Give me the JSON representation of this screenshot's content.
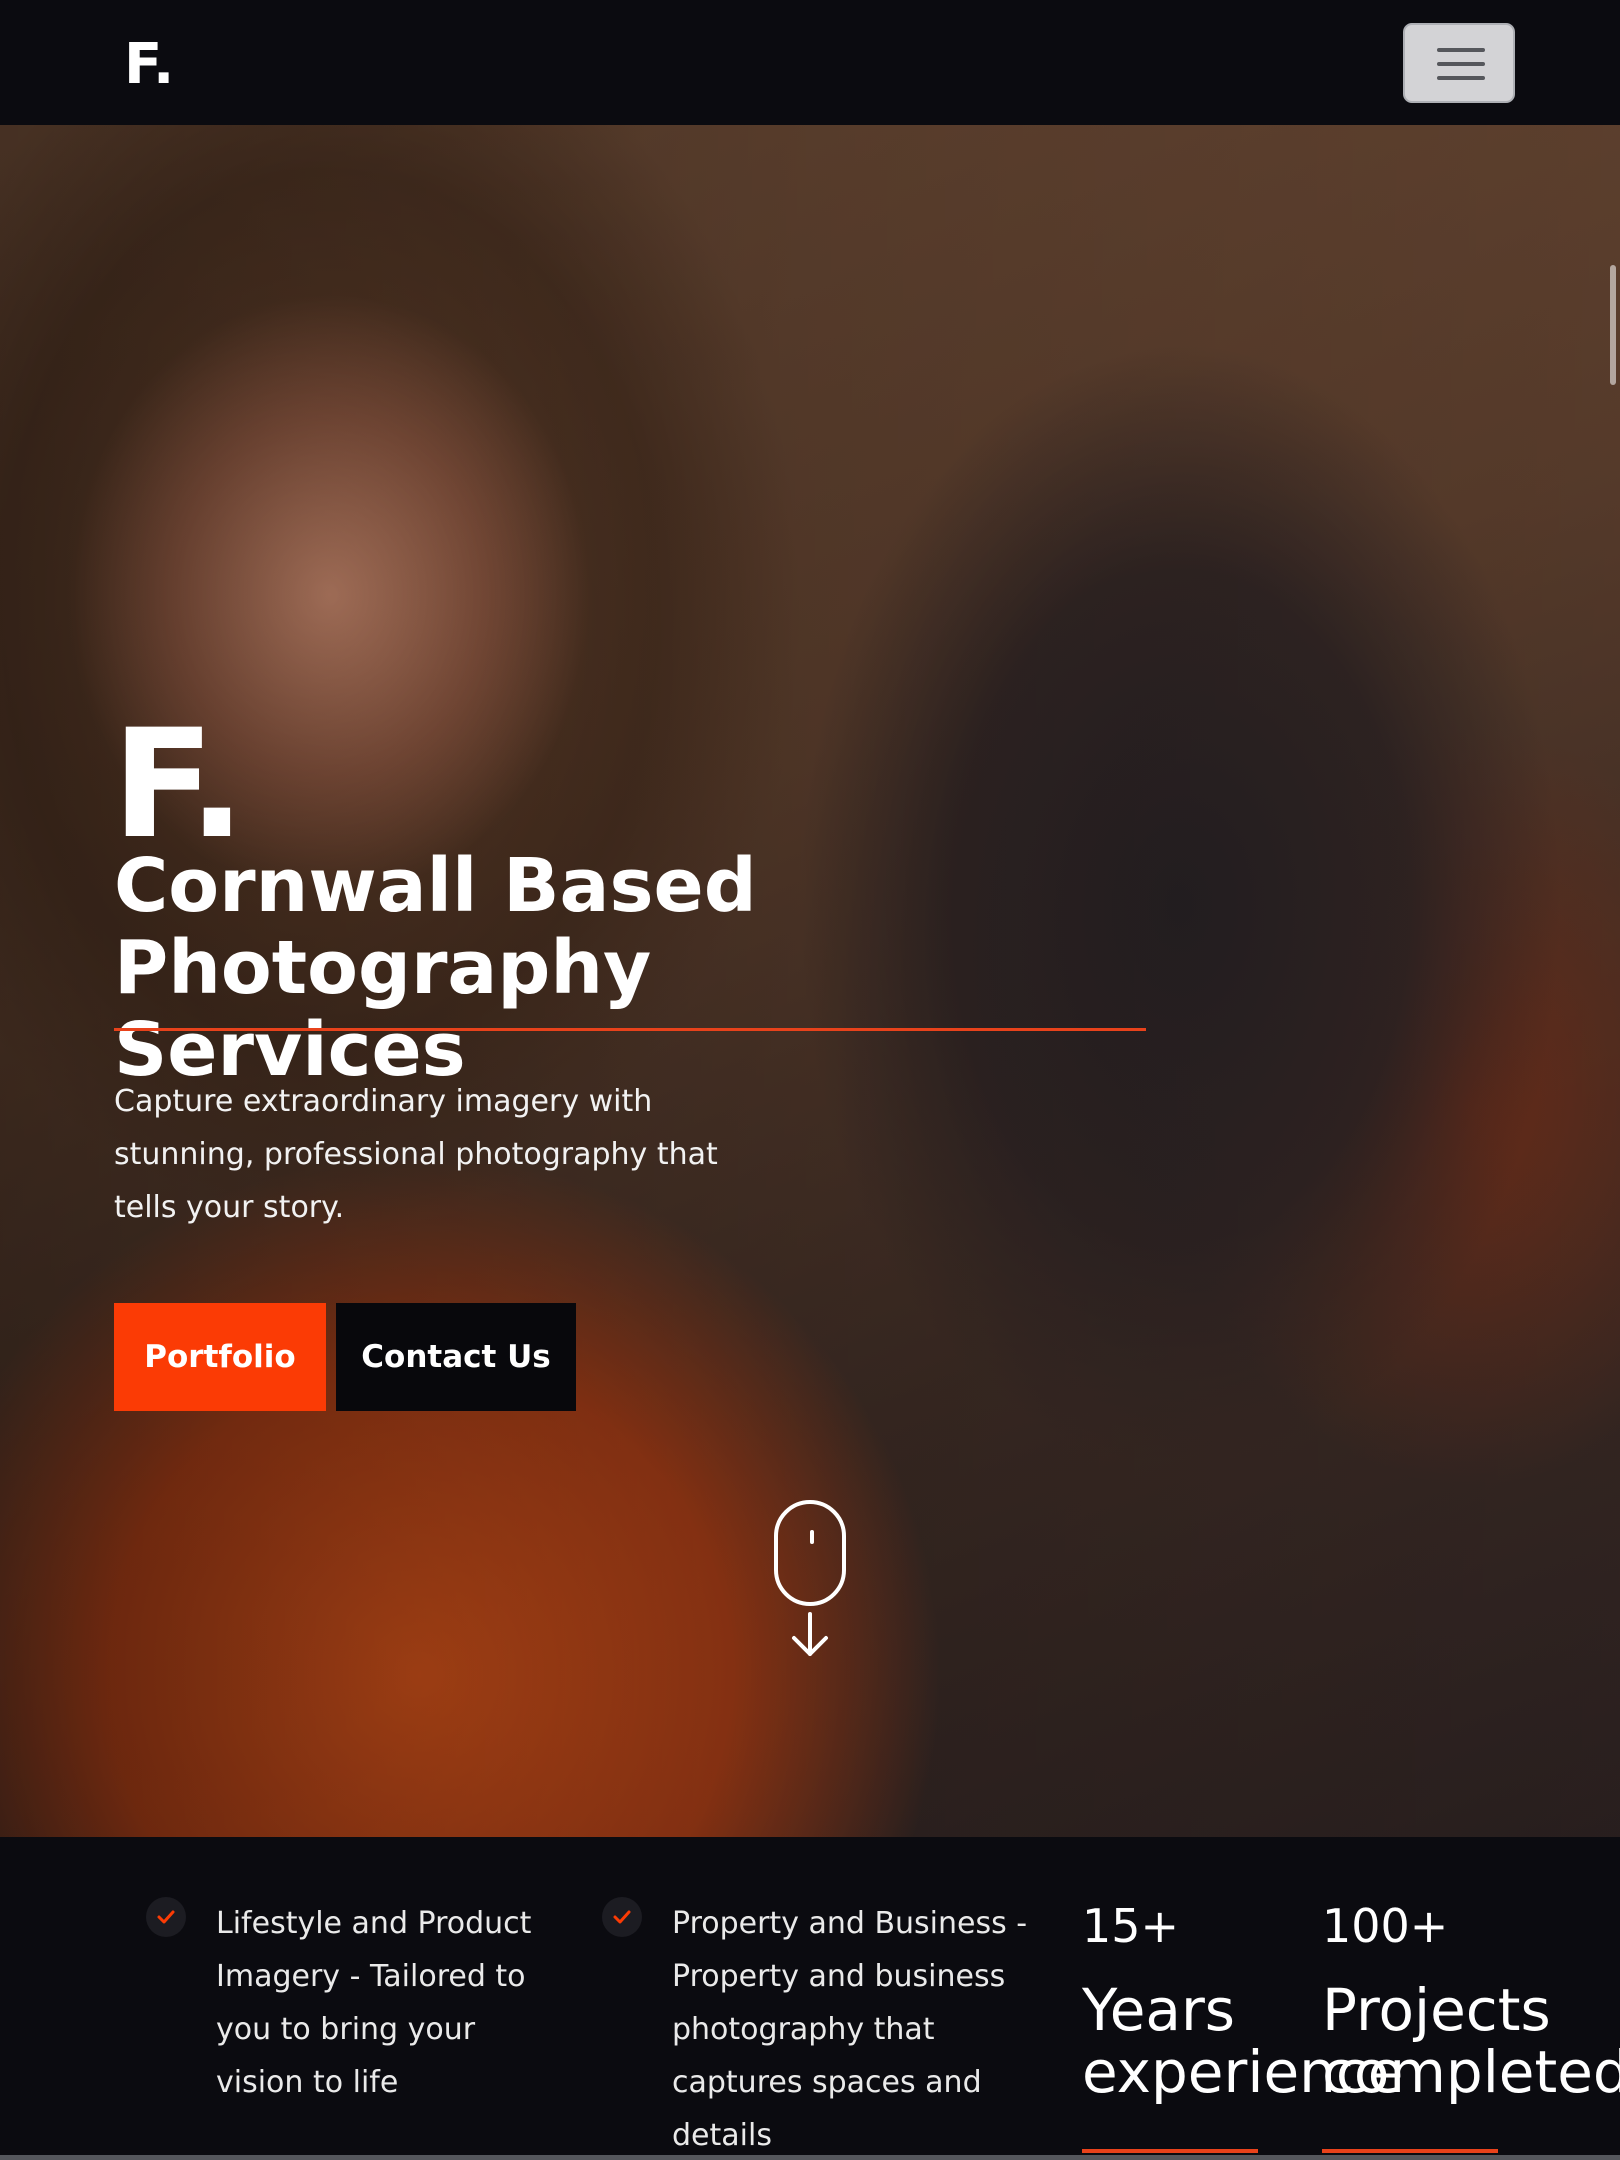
{
  "navbar": {
    "brand": "F.",
    "menu_icon": "hamburger-menu-icon"
  },
  "hero": {
    "logo": "F.",
    "title": "Cornwall Based Photography Services",
    "subtitle": "Capture extraordinary imagery with stunning, professional photography that tells your story.",
    "portfolio_label": "Portfolio",
    "contact_label": "Contact Us",
    "scroll_icon": "mouse-scroll-icon"
  },
  "features": [
    {
      "icon": "check-icon",
      "text": "Lifestyle and Product Imagery - Tailored to you to bring your vision to life"
    },
    {
      "icon": "check-icon",
      "text": "Property and Business - Property and business photography that captures spaces and details"
    }
  ],
  "stats": [
    {
      "number": "15+",
      "label": "Years experience"
    },
    {
      "number": "100+",
      "label": "Projects completed"
    }
  ],
  "colors": {
    "accent": "#fb3b05",
    "background": "#0b0b10",
    "button_dark": "#08080c"
  }
}
